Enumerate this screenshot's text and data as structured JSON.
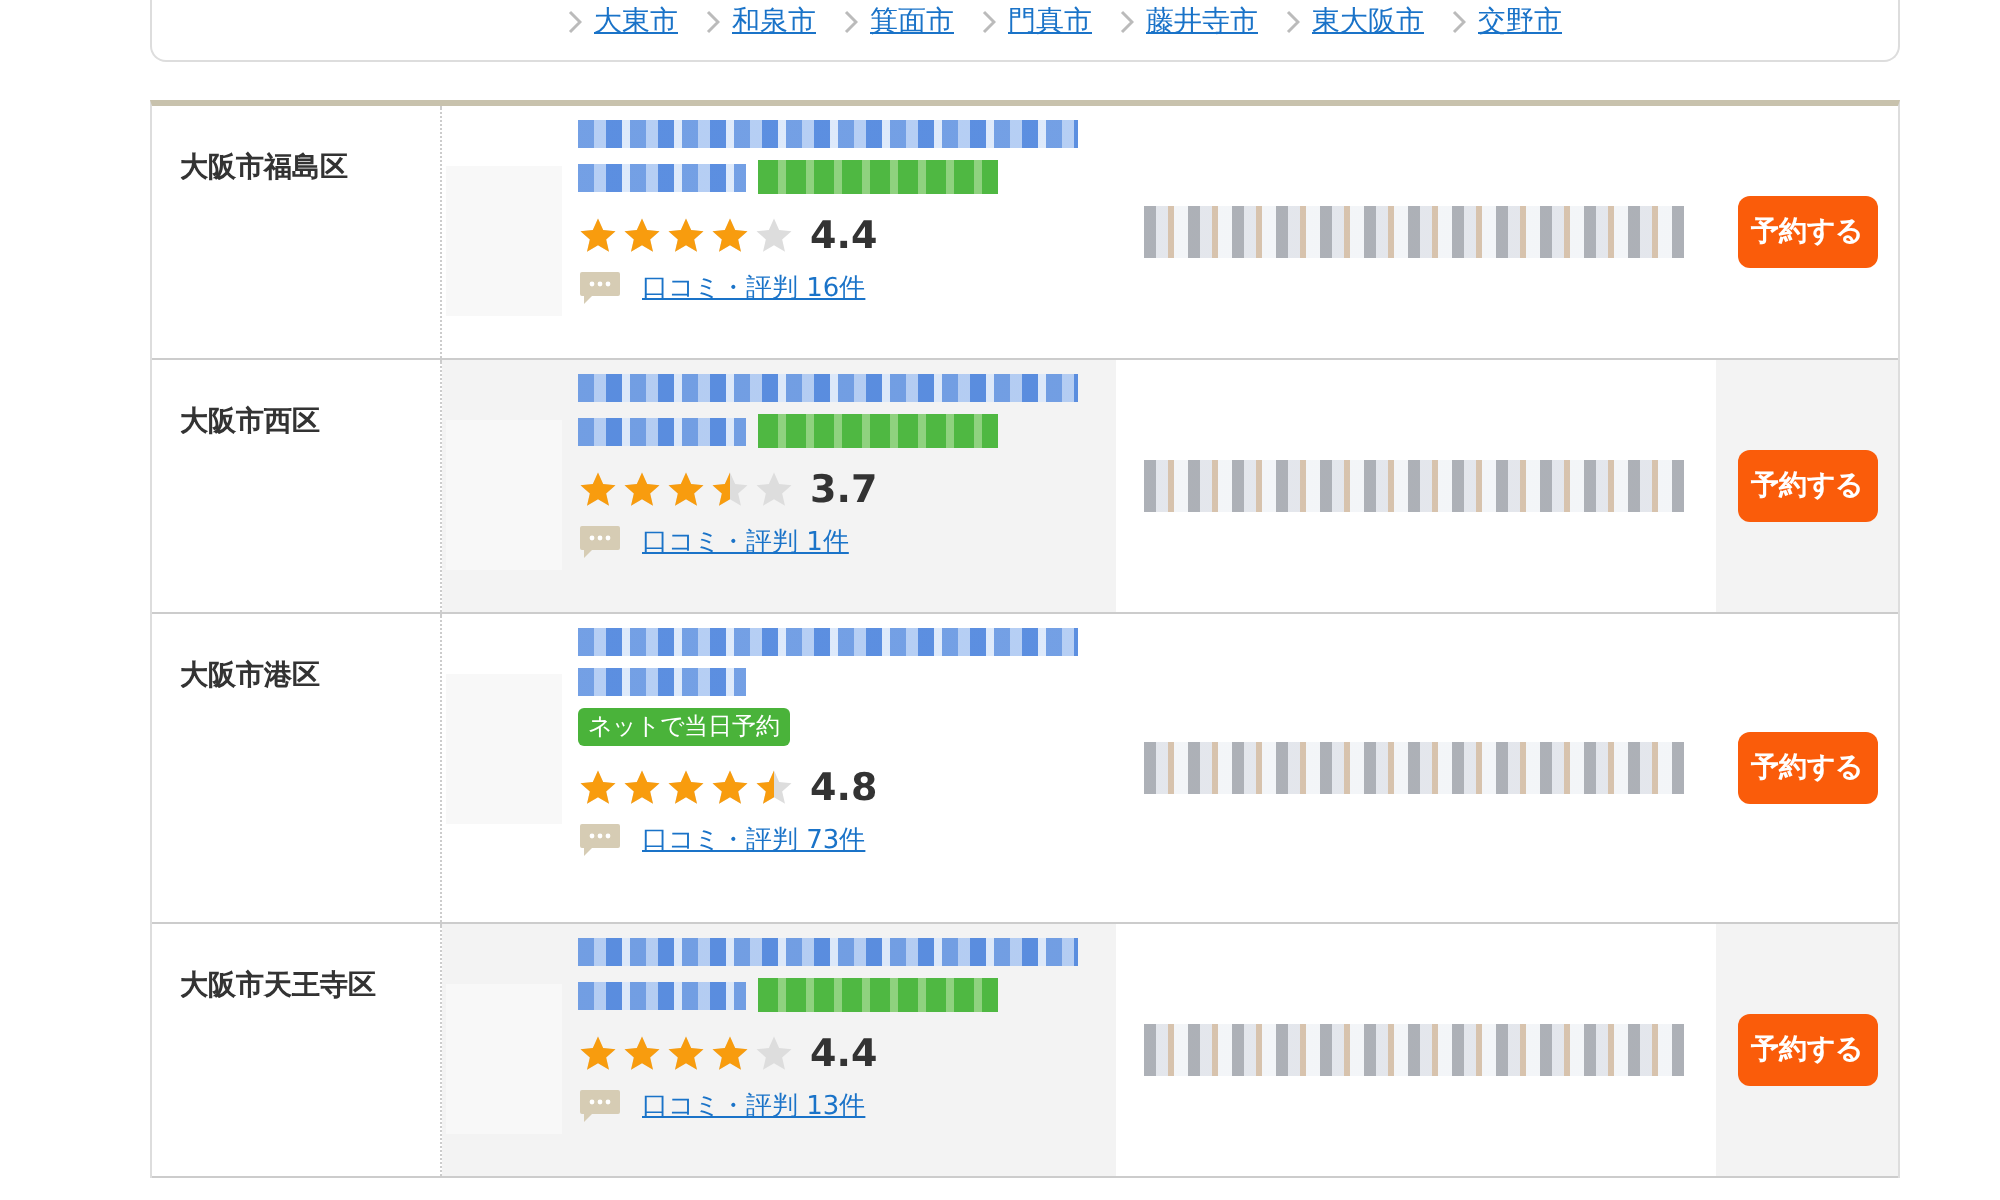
{
  "area_links": [
    {
      "label": "大東市"
    },
    {
      "label": "和泉市"
    },
    {
      "label": "箕面市"
    },
    {
      "label": "門真市"
    },
    {
      "label": "藤井寺市"
    },
    {
      "label": "東大阪市"
    },
    {
      "label": "交野市"
    }
  ],
  "listings": [
    {
      "area": "大阪市福島区",
      "stars": 4,
      "rating": "4.4",
      "reviews": "口コミ・評判 16件",
      "button": "予約する"
    },
    {
      "area": "大阪市西区",
      "stars": 3.5,
      "rating": "3.7",
      "reviews": "口コミ・評判 1件",
      "button": "予約する"
    },
    {
      "area": "大阪市港区",
      "badge": "ネットで当日予約",
      "stars": 4.5,
      "rating": "4.8",
      "reviews": "口コミ・評判 73件",
      "button": "予約する"
    },
    {
      "area": "大阪市天王寺区",
      "stars": 4,
      "rating": "4.4",
      "reviews": "口コミ・評判 13件",
      "button": "予約する"
    }
  ]
}
